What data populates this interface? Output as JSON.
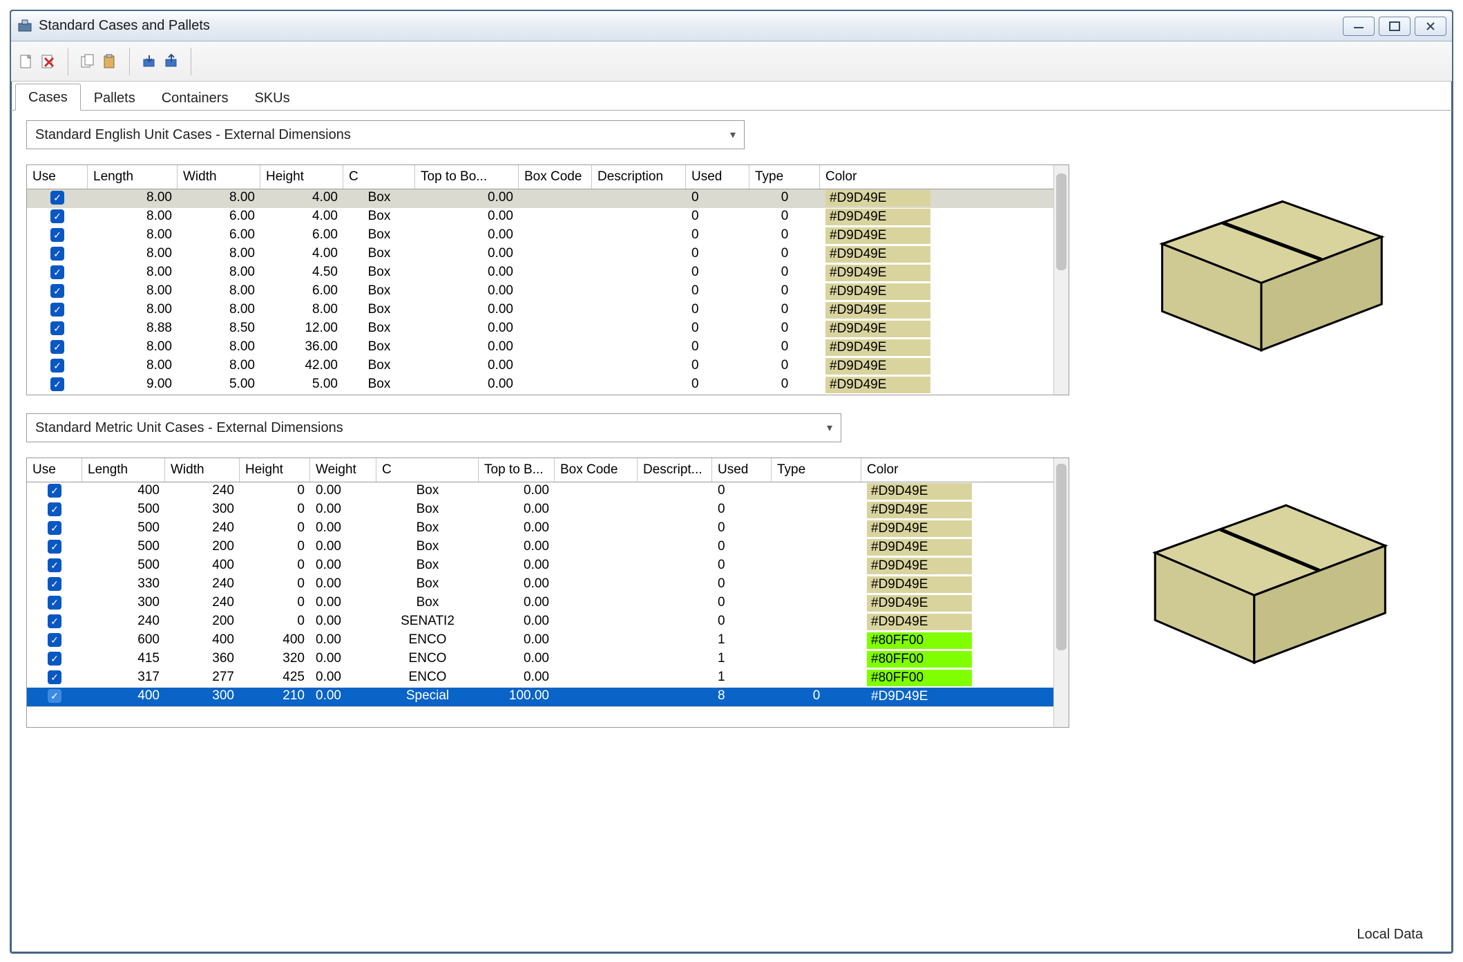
{
  "window": {
    "title": "Standard Cases and Pallets",
    "status": "Local Data"
  },
  "tabs": [
    "Cases",
    "Pallets",
    "Containers",
    "SKUs"
  ],
  "active_tab": 0,
  "section_a": {
    "selector": "Standard English Unit Cases - External Dimensions",
    "headers": [
      "Use",
      "Length",
      "Width",
      "Height",
      "C",
      "Top to Bo...",
      "Box Code",
      "Description",
      "Used",
      "Type",
      "Color"
    ],
    "rows": [
      {
        "use": true,
        "length": "8.00",
        "width": "8.00",
        "height": "4.00",
        "c": "Box",
        "top": "0.00",
        "code": "",
        "desc": "",
        "used": "0",
        "type": "0",
        "color": "#D9D49E",
        "chip": "tan",
        "sel": "soft"
      },
      {
        "use": true,
        "length": "8.00",
        "width": "6.00",
        "height": "4.00",
        "c": "Box",
        "top": "0.00",
        "code": "",
        "desc": "",
        "used": "0",
        "type": "0",
        "color": "#D9D49E",
        "chip": "tan"
      },
      {
        "use": true,
        "length": "8.00",
        "width": "6.00",
        "height": "6.00",
        "c": "Box",
        "top": "0.00",
        "code": "",
        "desc": "",
        "used": "0",
        "type": "0",
        "color": "#D9D49E",
        "chip": "tan"
      },
      {
        "use": true,
        "length": "8.00",
        "width": "8.00",
        "height": "4.00",
        "c": "Box",
        "top": "0.00",
        "code": "",
        "desc": "",
        "used": "0",
        "type": "0",
        "color": "#D9D49E",
        "chip": "tan"
      },
      {
        "use": true,
        "length": "8.00",
        "width": "8.00",
        "height": "4.50",
        "c": "Box",
        "top": "0.00",
        "code": "",
        "desc": "",
        "used": "0",
        "type": "0",
        "color": "#D9D49E",
        "chip": "tan"
      },
      {
        "use": true,
        "length": "8.00",
        "width": "8.00",
        "height": "6.00",
        "c": "Box",
        "top": "0.00",
        "code": "",
        "desc": "",
        "used": "0",
        "type": "0",
        "color": "#D9D49E",
        "chip": "tan"
      },
      {
        "use": true,
        "length": "8.00",
        "width": "8.00",
        "height": "8.00",
        "c": "Box",
        "top": "0.00",
        "code": "",
        "desc": "",
        "used": "0",
        "type": "0",
        "color": "#D9D49E",
        "chip": "tan"
      },
      {
        "use": true,
        "length": "8.88",
        "width": "8.50",
        "height": "12.00",
        "c": "Box",
        "top": "0.00",
        "code": "",
        "desc": "",
        "used": "0",
        "type": "0",
        "color": "#D9D49E",
        "chip": "tan"
      },
      {
        "use": true,
        "length": "8.00",
        "width": "8.00",
        "height": "36.00",
        "c": "Box",
        "top": "0.00",
        "code": "",
        "desc": "",
        "used": "0",
        "type": "0",
        "color": "#D9D49E",
        "chip": "tan"
      },
      {
        "use": true,
        "length": "8.00",
        "width": "8.00",
        "height": "42.00",
        "c": "Box",
        "top": "0.00",
        "code": "",
        "desc": "",
        "used": "0",
        "type": "0",
        "color": "#D9D49E",
        "chip": "tan"
      },
      {
        "use": true,
        "length": "9.00",
        "width": "5.00",
        "height": "5.00",
        "c": "Box",
        "top": "0.00",
        "code": "",
        "desc": "",
        "used": "0",
        "type": "0",
        "color": "#D9D49E",
        "chip": "tan"
      }
    ]
  },
  "section_b": {
    "selector": "Standard Metric Unit Cases - External Dimensions",
    "headers": [
      "Use",
      "Length",
      "Width",
      "Height",
      "Weight",
      "C",
      "Top to B...",
      "Box Code",
      "Descript...",
      "Used",
      "Type",
      "Color"
    ],
    "rows": [
      {
        "use": true,
        "length": "400",
        "width": "240",
        "height": "0",
        "weight": "0.00",
        "c": "Box",
        "top": "0.00",
        "code": "",
        "desc": "",
        "used": "0",
        "type": "",
        "color": "#D9D49E",
        "chip": "tan"
      },
      {
        "use": true,
        "length": "500",
        "width": "300",
        "height": "0",
        "weight": "0.00",
        "c": "Box",
        "top": "0.00",
        "code": "",
        "desc": "",
        "used": "0",
        "type": "",
        "color": "#D9D49E",
        "chip": "tan"
      },
      {
        "use": true,
        "length": "500",
        "width": "240",
        "height": "0",
        "weight": "0.00",
        "c": "Box",
        "top": "0.00",
        "code": "",
        "desc": "",
        "used": "0",
        "type": "",
        "color": "#D9D49E",
        "chip": "tan"
      },
      {
        "use": true,
        "length": "500",
        "width": "200",
        "height": "0",
        "weight": "0.00",
        "c": "Box",
        "top": "0.00",
        "code": "",
        "desc": "",
        "used": "0",
        "type": "",
        "color": "#D9D49E",
        "chip": "tan"
      },
      {
        "use": true,
        "length": "500",
        "width": "400",
        "height": "0",
        "weight": "0.00",
        "c": "Box",
        "top": "0.00",
        "code": "",
        "desc": "",
        "used": "0",
        "type": "",
        "color": "#D9D49E",
        "chip": "tan"
      },
      {
        "use": true,
        "length": "330",
        "width": "240",
        "height": "0",
        "weight": "0.00",
        "c": "Box",
        "top": "0.00",
        "code": "",
        "desc": "",
        "used": "0",
        "type": "",
        "color": "#D9D49E",
        "chip": "tan"
      },
      {
        "use": true,
        "length": "300",
        "width": "240",
        "height": "0",
        "weight": "0.00",
        "c": "Box",
        "top": "0.00",
        "code": "",
        "desc": "",
        "used": "0",
        "type": "",
        "color": "#D9D49E",
        "chip": "tan"
      },
      {
        "use": true,
        "length": "240",
        "width": "200",
        "height": "0",
        "weight": "0.00",
        "c": "SENATI2",
        "top": "0.00",
        "code": "",
        "desc": "",
        "used": "0",
        "type": "",
        "color": "#D9D49E",
        "chip": "tan"
      },
      {
        "use": true,
        "length": "600",
        "width": "400",
        "height": "400",
        "weight": "0.00",
        "c": "ENCO",
        "top": "0.00",
        "code": "",
        "desc": "",
        "used": "1",
        "type": "",
        "color": "#80FF00",
        "chip": "lime"
      },
      {
        "use": true,
        "length": "415",
        "width": "360",
        "height": "320",
        "weight": "0.00",
        "c": "ENCO",
        "top": "0.00",
        "code": "",
        "desc": "",
        "used": "1",
        "type": "",
        "color": "#80FF00",
        "chip": "lime"
      },
      {
        "use": true,
        "length": "317",
        "width": "277",
        "height": "425",
        "weight": "0.00",
        "c": "ENCO",
        "top": "0.00",
        "code": "",
        "desc": "",
        "used": "1",
        "type": "",
        "color": "#80FF00",
        "chip": "lime"
      },
      {
        "use": true,
        "length": "400",
        "width": "300",
        "height": "210",
        "weight": "0.00",
        "c": "Special",
        "top": "100.00",
        "code": "",
        "desc": "",
        "used": "8",
        "type": "0",
        "color": "#D9D49E",
        "chip": "tan",
        "sel": "hard"
      }
    ]
  }
}
